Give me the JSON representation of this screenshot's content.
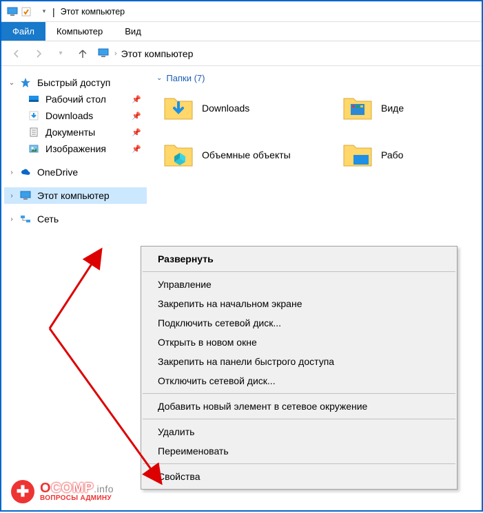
{
  "window": {
    "title": "Этот компьютер"
  },
  "ribbon": {
    "file": "Файл",
    "computer": "Компьютер",
    "view": "Вид"
  },
  "breadcrumb": {
    "root": "Этот компьютер"
  },
  "tree": {
    "quick_access": "Быстрый доступ",
    "desktop": "Рабочий стол",
    "downloads": "Downloads",
    "documents": "Документы",
    "pictures": "Изображения",
    "onedrive": "OneDrive",
    "this_pc": "Этот компьютер",
    "network": "Сеть"
  },
  "content": {
    "group_header": "Папки (7)",
    "folders": {
      "downloads": "Downloads",
      "videos": "Виде",
      "objects3d": "Объемные объекты",
      "desktop": "Рабо"
    }
  },
  "context_menu": {
    "expand": "Развернуть",
    "manage": "Управление",
    "pin_start": "Закрепить на начальном экране",
    "map_drive": "Подключить сетевой диск...",
    "new_window": "Открыть в новом окне",
    "pin_quick": "Закрепить на панели быстрого доступа",
    "disconnect_drive": "Отключить сетевой диск...",
    "add_network_loc": "Добавить новый элемент в сетевое окружение",
    "delete": "Удалить",
    "rename": "Переименовать",
    "properties": "Свойства"
  },
  "watermark": {
    "brand_o": "O",
    "brand_rest": "COMP",
    "brand_suffix": ".info",
    "tagline": "ВОПРОСЫ АДМИНУ"
  }
}
